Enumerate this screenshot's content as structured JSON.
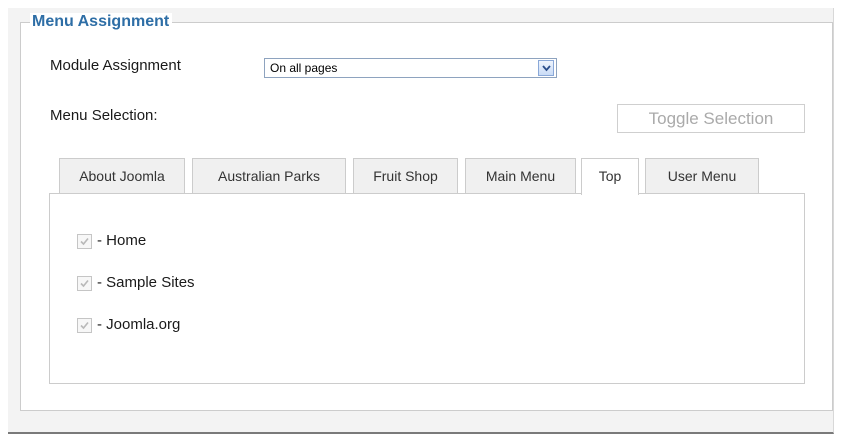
{
  "fieldset": {
    "legend": "Menu Assignment"
  },
  "module_assignment": {
    "label": "Module Assignment",
    "value": "On all pages"
  },
  "menu_selection": {
    "label": "Menu Selection:",
    "toggle_label": "Toggle Selection"
  },
  "tabs": [
    {
      "label": "About Joomla",
      "active": false
    },
    {
      "label": "Australian Parks",
      "active": false
    },
    {
      "label": "Fruit Shop",
      "active": false
    },
    {
      "label": "Main Menu",
      "active": false
    },
    {
      "label": "Top",
      "active": true
    },
    {
      "label": "User Menu",
      "active": false
    }
  ],
  "items": [
    {
      "label": "- Home",
      "checked": true
    },
    {
      "label": "- Sample Sites",
      "checked": true
    },
    {
      "label": "- Joomla.org",
      "checked": true
    }
  ],
  "colors": {
    "legend": "#2e6ea6",
    "border": "#cccccc",
    "disabled_text": "#aaaaaa"
  }
}
